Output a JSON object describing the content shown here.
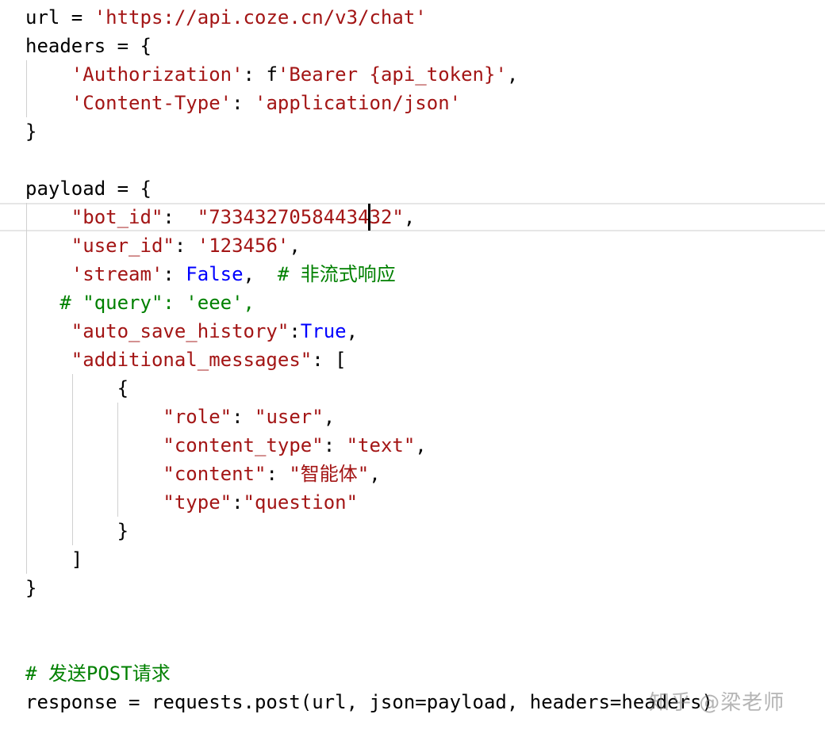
{
  "editor": {
    "lines": [
      [
        {
          "t": "url = ",
          "c": "plain"
        },
        {
          "t": "'https://api.coze.cn/v3/chat'",
          "c": "str"
        }
      ],
      [
        {
          "t": "headers = {",
          "c": "plain"
        }
      ],
      [
        {
          "t": "    ",
          "c": "plain"
        },
        {
          "t": "'Authorization'",
          "c": "str"
        },
        {
          "t": ": f",
          "c": "plain"
        },
        {
          "t": "'Bearer {api_token}'",
          "c": "str"
        },
        {
          "t": ",",
          "c": "plain"
        }
      ],
      [
        {
          "t": "    ",
          "c": "plain"
        },
        {
          "t": "'Content-Type'",
          "c": "str"
        },
        {
          "t": ": ",
          "c": "plain"
        },
        {
          "t": "'application/json'",
          "c": "str"
        }
      ],
      [
        {
          "t": "}",
          "c": "plain"
        }
      ],
      [],
      [
        {
          "t": "payload = {",
          "c": "plain"
        }
      ],
      [
        {
          "t": "    ",
          "c": "plain"
        },
        {
          "t": "\"bot_id\"",
          "c": "str"
        },
        {
          "t": ":  ",
          "c": "plain"
        },
        {
          "t": "\"7334327058443432\"",
          "c": "str"
        },
        {
          "t": ",",
          "c": "plain"
        }
      ],
      [
        {
          "t": "    ",
          "c": "plain"
        },
        {
          "t": "\"user_id\"",
          "c": "str"
        },
        {
          "t": ": ",
          "c": "plain"
        },
        {
          "t": "'123456'",
          "c": "str"
        },
        {
          "t": ",",
          "c": "plain"
        }
      ],
      [
        {
          "t": "    ",
          "c": "plain"
        },
        {
          "t": "'stream'",
          "c": "str"
        },
        {
          "t": ": ",
          "c": "plain"
        },
        {
          "t": "False",
          "c": "kw"
        },
        {
          "t": ",  ",
          "c": "plain"
        },
        {
          "t": "# 非流式响应",
          "c": "cm"
        }
      ],
      [
        {
          "t": "   ",
          "c": "plain"
        },
        {
          "t": "# \"query\": 'eee',",
          "c": "cm"
        }
      ],
      [
        {
          "t": "    ",
          "c": "plain"
        },
        {
          "t": "\"auto_save_history\"",
          "c": "str"
        },
        {
          "t": ":",
          "c": "plain"
        },
        {
          "t": "True",
          "c": "kw"
        },
        {
          "t": ",",
          "c": "plain"
        }
      ],
      [
        {
          "t": "    ",
          "c": "plain"
        },
        {
          "t": "\"additional_messages\"",
          "c": "str"
        },
        {
          "t": ": [",
          "c": "plain"
        }
      ],
      [
        {
          "t": "        {",
          "c": "plain"
        }
      ],
      [
        {
          "t": "            ",
          "c": "plain"
        },
        {
          "t": "\"role\"",
          "c": "str"
        },
        {
          "t": ": ",
          "c": "plain"
        },
        {
          "t": "\"user\"",
          "c": "str"
        },
        {
          "t": ",",
          "c": "plain"
        }
      ],
      [
        {
          "t": "            ",
          "c": "plain"
        },
        {
          "t": "\"content_type\"",
          "c": "str"
        },
        {
          "t": ": ",
          "c": "plain"
        },
        {
          "t": "\"text\"",
          "c": "str"
        },
        {
          "t": ",",
          "c": "plain"
        }
      ],
      [
        {
          "t": "            ",
          "c": "plain"
        },
        {
          "t": "\"content\"",
          "c": "str"
        },
        {
          "t": ": ",
          "c": "plain"
        },
        {
          "t": "\"智能体\"",
          "c": "str"
        },
        {
          "t": ",",
          "c": "plain"
        }
      ],
      [
        {
          "t": "            ",
          "c": "plain"
        },
        {
          "t": "\"type\"",
          "c": "str"
        },
        {
          "t": ":",
          "c": "plain"
        },
        {
          "t": "\"question\"",
          "c": "str"
        }
      ],
      [
        {
          "t": "        }",
          "c": "plain"
        }
      ],
      [
        {
          "t": "    ]",
          "c": "plain"
        }
      ],
      [
        {
          "t": "}",
          "c": "plain"
        }
      ],
      [],
      [],
      [
        {
          "t": "# 发送POST请求",
          "c": "cm"
        }
      ],
      [
        {
          "t": "response = requests.post(url, json=payload, headers=headers)",
          "c": "plain"
        }
      ]
    ]
  },
  "watermark": "知乎 @梁老师"
}
